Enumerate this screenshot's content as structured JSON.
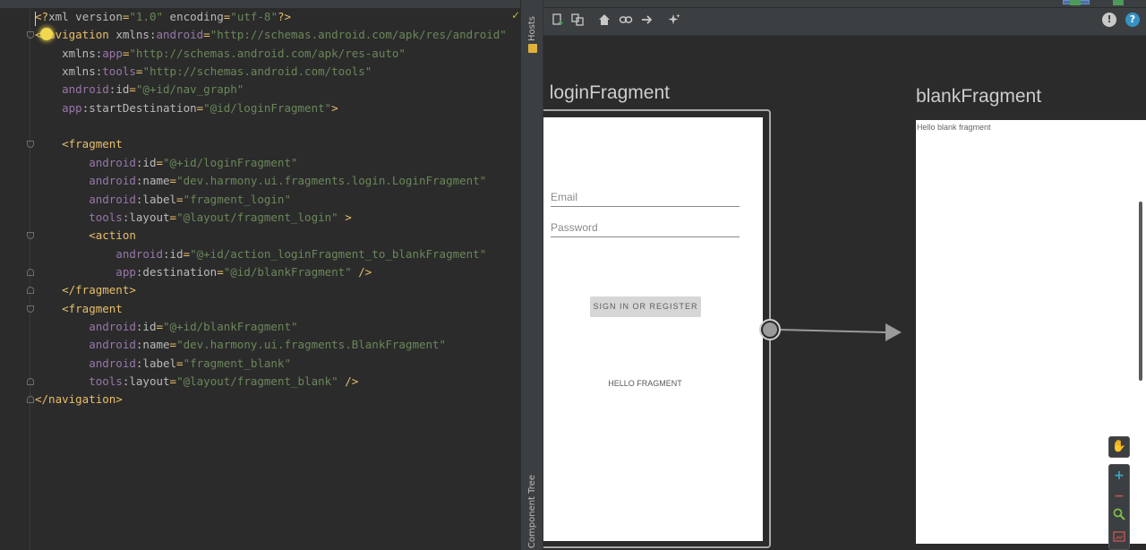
{
  "editor": {
    "lines": [
      [
        [
          "t-punc",
          "<?"
        ],
        [
          "t-attr",
          "xml version"
        ],
        [
          "t-punc",
          "="
        ],
        [
          "t-val",
          "\"1.0\""
        ],
        [
          "t-attr",
          " encoding"
        ],
        [
          "t-punc",
          "="
        ],
        [
          "t-val",
          "\"utf-8\""
        ],
        [
          "t-punc",
          "?>"
        ]
      ],
      [
        [
          "t-tag",
          "<navigation "
        ],
        [
          "t-attr",
          "xmlns:"
        ],
        [
          "t-ns",
          "android"
        ],
        [
          "t-punc",
          "="
        ],
        [
          "t-val",
          "\"http://schemas.android.com/apk/res/android\""
        ]
      ],
      [
        [
          "t-attr",
          "    xmlns:"
        ],
        [
          "t-ns",
          "app"
        ],
        [
          "t-punc",
          "="
        ],
        [
          "t-val",
          "\"http://schemas.android.com/apk/res-auto\""
        ]
      ],
      [
        [
          "t-attr",
          "    xmlns:"
        ],
        [
          "t-ns",
          "tools"
        ],
        [
          "t-punc",
          "="
        ],
        [
          "t-val",
          "\"http://schemas.android.com/tools\""
        ]
      ],
      [
        [
          "t-ns",
          "    android"
        ],
        [
          "t-attr",
          ":id"
        ],
        [
          "t-punc",
          "="
        ],
        [
          "t-val",
          "\"@+id/nav_graph\""
        ]
      ],
      [
        [
          "t-ns",
          "    app"
        ],
        [
          "t-attr",
          ":startDestination"
        ],
        [
          "t-punc",
          "="
        ],
        [
          "t-val",
          "\"@id/loginFragment\""
        ],
        [
          "t-tag",
          ">"
        ]
      ],
      [],
      [
        [
          "t-tag",
          "    <fragment"
        ]
      ],
      [
        [
          "t-ns",
          "        android"
        ],
        [
          "t-attr",
          ":id"
        ],
        [
          "t-punc",
          "="
        ],
        [
          "t-val",
          "\"@+id/loginFragment\""
        ]
      ],
      [
        [
          "t-ns",
          "        android"
        ],
        [
          "t-attr",
          ":name"
        ],
        [
          "t-punc",
          "="
        ],
        [
          "t-val",
          "\"dev.harmony.ui.fragments.login.LoginFragment\""
        ]
      ],
      [
        [
          "t-ns",
          "        android"
        ],
        [
          "t-attr",
          ":label"
        ],
        [
          "t-punc",
          "="
        ],
        [
          "t-val",
          "\"fragment_login\""
        ]
      ],
      [
        [
          "t-ns",
          "        tools"
        ],
        [
          "t-attr",
          ":layout"
        ],
        [
          "t-punc",
          "="
        ],
        [
          "t-val",
          "\"@layout/fragment_login\""
        ],
        [
          "t-tag",
          " >"
        ]
      ],
      [
        [
          "t-tag",
          "        <action"
        ]
      ],
      [
        [
          "t-ns",
          "            android"
        ],
        [
          "t-attr",
          ":id"
        ],
        [
          "t-punc",
          "="
        ],
        [
          "t-val",
          "\"@+id/action_loginFragment_to_blankFragment\""
        ]
      ],
      [
        [
          "t-ns",
          "            app"
        ],
        [
          "t-attr",
          ":destination"
        ],
        [
          "t-punc",
          "="
        ],
        [
          "t-val",
          "\"@id/blankFragment\""
        ],
        [
          "t-tag",
          " />"
        ]
      ],
      [
        [
          "t-tag",
          "    </fragment>"
        ]
      ],
      [
        [
          "t-tag",
          "    <fragment"
        ]
      ],
      [
        [
          "t-ns",
          "        android"
        ],
        [
          "t-attr",
          ":id"
        ],
        [
          "t-punc",
          "="
        ],
        [
          "t-val",
          "\"@+id/blankFragment\""
        ]
      ],
      [
        [
          "t-ns",
          "        android"
        ],
        [
          "t-attr",
          ":name"
        ],
        [
          "t-punc",
          "="
        ],
        [
          "t-val",
          "\"dev.harmony.ui.fragments.BlankFragment\""
        ]
      ],
      [
        [
          "t-ns",
          "        android"
        ],
        [
          "t-attr",
          ":label"
        ],
        [
          "t-punc",
          "="
        ],
        [
          "t-val",
          "\"fragment_blank\""
        ]
      ],
      [
        [
          "t-ns",
          "        tools"
        ],
        [
          "t-attr",
          ":layout"
        ],
        [
          "t-punc",
          "="
        ],
        [
          "t-val",
          "\"@layout/fragment_blank\""
        ],
        [
          "t-tag",
          " />"
        ]
      ],
      [
        [
          "t-tag",
          "</navigation>"
        ]
      ]
    ],
    "folds": [
      {
        "line": 1,
        "kind": "open"
      },
      {
        "line": 7,
        "kind": "open"
      },
      {
        "line": 12,
        "kind": "open"
      },
      {
        "line": 14,
        "kind": "close"
      },
      {
        "line": 15,
        "kind": "close"
      },
      {
        "line": 16,
        "kind": "open"
      },
      {
        "line": 20,
        "kind": "close"
      },
      {
        "line": 21,
        "kind": "close"
      }
    ]
  },
  "side_panel": {
    "hosts_label": "Hosts",
    "component_tree_label": "Component Tree"
  },
  "toolbar": {
    "icons": [
      "new-destination-icon",
      "copy-icon",
      "home-icon",
      "link-icon",
      "arrow-right-icon",
      "sparkle-icon"
    ],
    "warning_icon": "!",
    "help_icon": "?"
  },
  "nav_graph": {
    "login_fragment": {
      "title": "loginFragment",
      "email_placeholder": "Email",
      "password_placeholder": "Password",
      "signin_label": "SIGN IN OR REGISTER",
      "hello_text": "HELLO FRAGMENT"
    },
    "blank_fragment": {
      "title": "blankFragment",
      "hello_text": "Hello blank fragment"
    }
  },
  "colors": {
    "background": "#2b2b2b",
    "panel": "#3c3f41",
    "xml_tag": "#e8bf6a",
    "xml_namespace": "#9876aa",
    "xml_value": "#6a8759",
    "action_arrow": "#9a9a9a"
  }
}
